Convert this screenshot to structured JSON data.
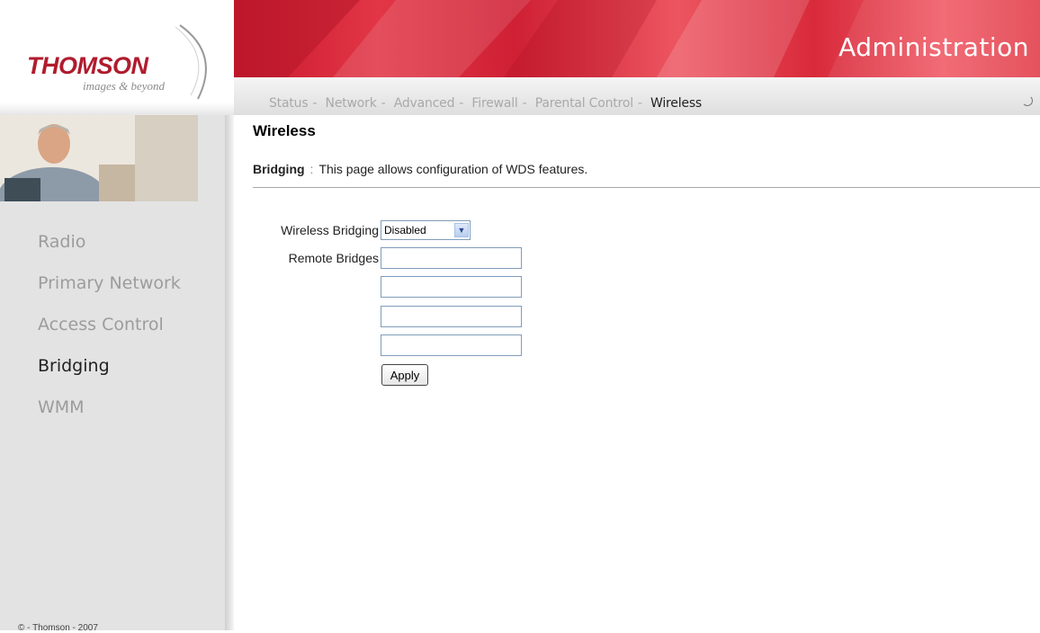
{
  "brand": {
    "logo_text": "THOMSON",
    "tagline": "images & beyond",
    "accent_color": "#d0283a"
  },
  "header": {
    "title": "Administration"
  },
  "nav": {
    "items": [
      {
        "label": "Status",
        "active": false
      },
      {
        "label": "Network",
        "active": false
      },
      {
        "label": "Advanced",
        "active": false
      },
      {
        "label": "Firewall",
        "active": false
      },
      {
        "label": "Parental Control",
        "active": false
      },
      {
        "label": "Wireless",
        "active": true
      }
    ],
    "separator": "-"
  },
  "sidebar": {
    "items": [
      {
        "label": "Radio",
        "active": false
      },
      {
        "label": "Primary Network",
        "active": false
      },
      {
        "label": "Access Control",
        "active": false
      },
      {
        "label": "Bridging",
        "active": true
      },
      {
        "label": "WMM",
        "active": false
      }
    ],
    "copyright": "© - Thomson - 2007"
  },
  "main": {
    "title": "Wireless",
    "section_name": "Bridging",
    "separator": ":",
    "description": "This page allows configuration of WDS features.",
    "form": {
      "wireless_bridging_label": "Wireless Bridging",
      "wireless_bridging_value": "Disabled",
      "remote_bridges_label": "Remote Bridges",
      "remote_bridges": [
        "",
        "",
        "",
        ""
      ],
      "apply_label": "Apply"
    }
  }
}
